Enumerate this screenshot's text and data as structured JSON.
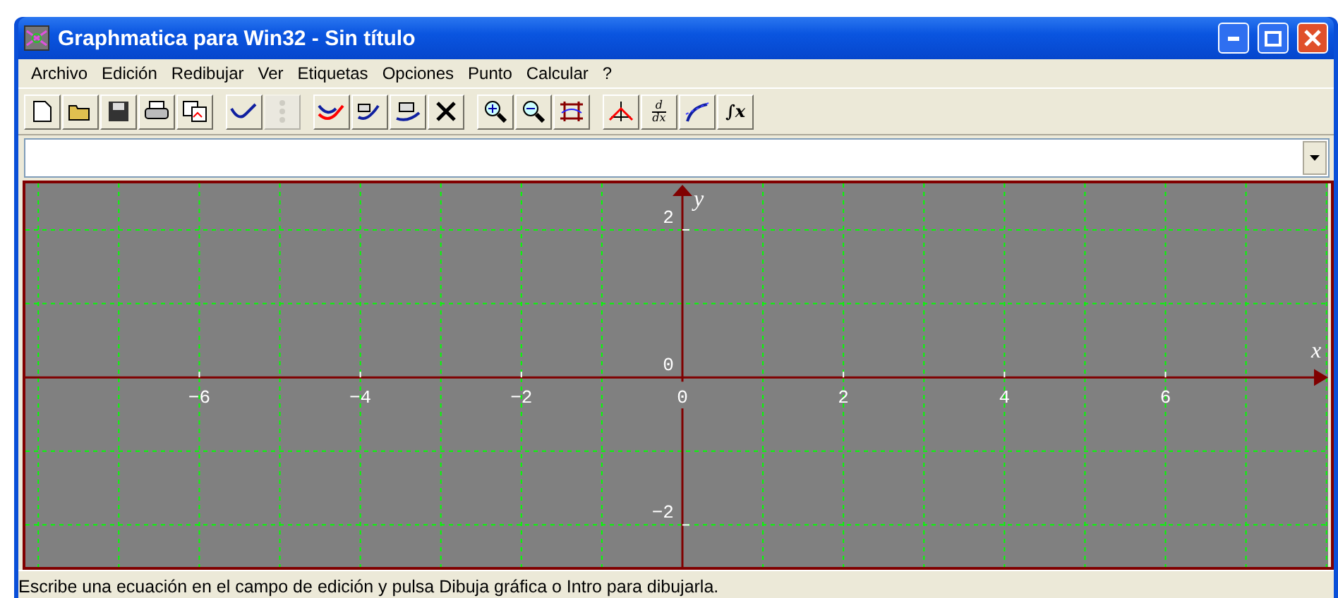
{
  "window": {
    "title": "Graphmatica para Win32 - Sin título"
  },
  "menu": [
    "Archivo",
    "Edición",
    "Redibujar",
    "Ver",
    "Etiquetas",
    "Opciones",
    "Punto",
    "Calcular",
    "?"
  ],
  "toolbar": [
    {
      "kind": "new",
      "disabled": false
    },
    {
      "kind": "open",
      "disabled": false
    },
    {
      "kind": "save",
      "disabled": false
    },
    {
      "kind": "print",
      "disabled": false
    },
    {
      "kind": "copy",
      "disabled": false
    },
    {
      "kind": "separator"
    },
    {
      "kind": "draw",
      "disabled": false
    },
    {
      "kind": "points",
      "disabled": true
    },
    {
      "kind": "separator"
    },
    {
      "kind": "graph-add",
      "disabled": false
    },
    {
      "kind": "graph-erase",
      "disabled": false
    },
    {
      "kind": "graph-clear",
      "disabled": false
    },
    {
      "kind": "delete",
      "disabled": false
    },
    {
      "kind": "separator"
    },
    {
      "kind": "zoom-in",
      "disabled": false
    },
    {
      "kind": "zoom-out",
      "disabled": false
    },
    {
      "kind": "grid",
      "disabled": false
    },
    {
      "kind": "separator"
    },
    {
      "kind": "axes",
      "disabled": false
    },
    {
      "kind": "derivative",
      "numerator": "d",
      "denominator": "dx",
      "disabled": false
    },
    {
      "kind": "tangent",
      "disabled": false
    },
    {
      "kind": "integral",
      "label": "∫x",
      "disabled": false
    }
  ],
  "graph": {
    "chart_data": {
      "type": "line",
      "grid": true,
      "xlabel": "x",
      "ylabel": "y",
      "xlim": [
        -8.16,
        8.02
      ],
      "ylim": [
        -2.57,
        2.63
      ],
      "xticks": [
        {
          "value": -6,
          "label": "−6"
        },
        {
          "value": -4,
          "label": "−4"
        },
        {
          "value": -2,
          "label": "−2"
        },
        {
          "value": 0,
          "label": "0"
        },
        {
          "value": 2,
          "label": "2"
        },
        {
          "value": 4,
          "label": "4"
        },
        {
          "value": 6,
          "label": "6"
        }
      ],
      "yticks": [
        {
          "value": 2,
          "label": "2"
        },
        {
          "value": 0,
          "label": "0"
        },
        {
          "value": -2,
          "label": "−2"
        }
      ]
    }
  },
  "status_bar": "Escribe una ecuación en el campo de edición y pulsa Dibuja gráfica o Intro para dibujarla."
}
